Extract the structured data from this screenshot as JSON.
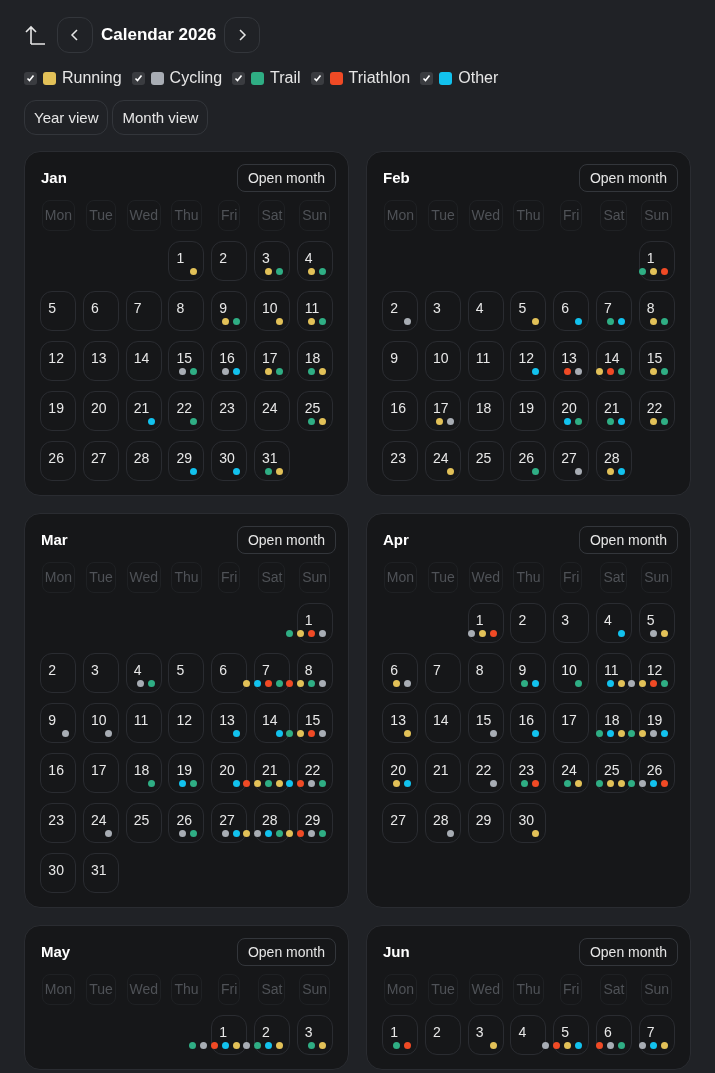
{
  "header": {
    "title": "Calendar 2026"
  },
  "categories": [
    {
      "label": "Running",
      "color": "#e2c158",
      "checked": true
    },
    {
      "label": "Cycling",
      "color": "#a8adb4",
      "checked": true
    },
    {
      "label": "Trail",
      "color": "#2fae84",
      "checked": true
    },
    {
      "label": "Triathlon",
      "color": "#f04a25",
      "checked": true
    },
    {
      "label": "Other",
      "color": "#12c2ee",
      "checked": true
    }
  ],
  "views": [
    {
      "label": "Year view"
    },
    {
      "label": "Month view"
    }
  ],
  "months": [
    {
      "name": "Jan",
      "button": "Open month",
      "weekdays": [
        "Mon",
        "Tue",
        "Wed",
        "Thu",
        "Fri",
        "Sat",
        "Sun"
      ],
      "days": [
        {
          "kind": "blank"
        },
        {
          "kind": "blank"
        },
        {
          "kind": "blank"
        },
        {
          "kind": "day",
          "day": "1",
          "dots": [
            {
              "color": "#e2c158"
            }
          ]
        },
        {
          "kind": "day",
          "day": "2"
        },
        {
          "kind": "day",
          "day": "3",
          "dots": [
            {
              "color": "#e2c158"
            },
            {
              "color": "#2fae84"
            }
          ]
        },
        {
          "kind": "day",
          "day": "4",
          "dots": [
            {
              "color": "#e2c158"
            },
            {
              "color": "#2fae84"
            }
          ]
        },
        {
          "kind": "day",
          "day": "5"
        },
        {
          "kind": "day",
          "day": "6"
        },
        {
          "kind": "day",
          "day": "7"
        },
        {
          "kind": "day",
          "day": "8"
        },
        {
          "kind": "day",
          "day": "9",
          "dots": [
            {
              "color": "#e2c158"
            },
            {
              "color": "#2fae84"
            }
          ]
        },
        {
          "kind": "day",
          "day": "10",
          "dots": [
            {
              "color": "#e2c158"
            }
          ]
        },
        {
          "kind": "day",
          "day": "11",
          "dots": [
            {
              "color": "#e2c158"
            },
            {
              "color": "#2fae84"
            }
          ]
        },
        {
          "kind": "day",
          "day": "12"
        },
        {
          "kind": "day",
          "day": "13"
        },
        {
          "kind": "day",
          "day": "14"
        },
        {
          "kind": "day",
          "day": "15",
          "dots": [
            {
              "color": "#a8adb4"
            },
            {
              "color": "#2fae84"
            }
          ]
        },
        {
          "kind": "day",
          "day": "16",
          "dots": [
            {
              "color": "#a8adb4"
            },
            {
              "color": "#12c2ee"
            }
          ]
        },
        {
          "kind": "day",
          "day": "17",
          "dots": [
            {
              "color": "#e2c158"
            },
            {
              "color": "#2fae84"
            }
          ]
        },
        {
          "kind": "day",
          "day": "18",
          "dots": [
            {
              "color": "#2fae84"
            },
            {
              "color": "#e2c158"
            }
          ]
        },
        {
          "kind": "day",
          "day": "19"
        },
        {
          "kind": "day",
          "day": "20"
        },
        {
          "kind": "day",
          "day": "21",
          "dots": [
            {
              "color": "#12c2ee"
            }
          ]
        },
        {
          "kind": "day",
          "day": "22",
          "dots": [
            {
              "color": "#2fae84"
            }
          ]
        },
        {
          "kind": "day",
          "day": "23"
        },
        {
          "kind": "day",
          "day": "24"
        },
        {
          "kind": "day",
          "day": "25",
          "dots": [
            {
              "color": "#2fae84"
            },
            {
              "color": "#e2c158"
            }
          ]
        },
        {
          "kind": "day",
          "day": "26"
        },
        {
          "kind": "day",
          "day": "27"
        },
        {
          "kind": "day",
          "day": "28"
        },
        {
          "kind": "day",
          "day": "29",
          "dots": [
            {
              "color": "#12c2ee"
            }
          ]
        },
        {
          "kind": "day",
          "day": "30",
          "dots": [
            {
              "color": "#12c2ee"
            }
          ]
        },
        {
          "kind": "day",
          "day": "31",
          "dots": [
            {
              "color": "#2fae84"
            },
            {
              "color": "#e2c158"
            }
          ]
        }
      ]
    },
    {
      "name": "Feb",
      "button": "Open month",
      "weekdays": [
        "Mon",
        "Tue",
        "Wed",
        "Thu",
        "Fri",
        "Sat",
        "Sun"
      ],
      "days": [
        {
          "kind": "blank"
        },
        {
          "kind": "blank"
        },
        {
          "kind": "blank"
        },
        {
          "kind": "blank"
        },
        {
          "kind": "blank"
        },
        {
          "kind": "blank"
        },
        {
          "kind": "day",
          "day": "1",
          "dots": [
            {
              "color": "#2fae84"
            },
            {
              "color": "#e2c158"
            },
            {
              "color": "#f04a25"
            }
          ]
        },
        {
          "kind": "day",
          "day": "2",
          "dots": [
            {
              "color": "#a8adb4"
            }
          ]
        },
        {
          "kind": "day",
          "day": "3"
        },
        {
          "kind": "day",
          "day": "4"
        },
        {
          "kind": "day",
          "day": "5",
          "dots": [
            {
              "color": "#e2c158"
            }
          ]
        },
        {
          "kind": "day",
          "day": "6",
          "dots": [
            {
              "color": "#12c2ee"
            }
          ]
        },
        {
          "kind": "day",
          "day": "7",
          "dots": [
            {
              "color": "#2fae84"
            },
            {
              "color": "#12c2ee"
            }
          ]
        },
        {
          "kind": "day",
          "day": "8",
          "dots": [
            {
              "color": "#e2c158"
            },
            {
              "color": "#2fae84"
            }
          ]
        },
        {
          "kind": "day",
          "day": "9"
        },
        {
          "kind": "day",
          "day": "10"
        },
        {
          "kind": "day",
          "day": "11"
        },
        {
          "kind": "day",
          "day": "12",
          "dots": [
            {
              "color": "#12c2ee"
            }
          ]
        },
        {
          "kind": "day",
          "day": "13",
          "dots": [
            {
              "color": "#f04a25"
            },
            {
              "color": "#a8adb4"
            }
          ]
        },
        {
          "kind": "day",
          "day": "14",
          "dots": [
            {
              "color": "#e2c158"
            },
            {
              "color": "#f04a25"
            },
            {
              "color": "#2fae84"
            }
          ]
        },
        {
          "kind": "day",
          "day": "15",
          "dots": [
            {
              "color": "#e2c158"
            },
            {
              "color": "#2fae84"
            }
          ]
        },
        {
          "kind": "day",
          "day": "16"
        },
        {
          "kind": "day",
          "day": "17",
          "dots": [
            {
              "color": "#e2c158"
            },
            {
              "color": "#a8adb4"
            }
          ]
        },
        {
          "kind": "day",
          "day": "18"
        },
        {
          "kind": "day",
          "day": "19"
        },
        {
          "kind": "day",
          "day": "20",
          "dots": [
            {
              "color": "#12c2ee"
            },
            {
              "color": "#2fae84"
            }
          ]
        },
        {
          "kind": "day",
          "day": "21",
          "dots": [
            {
              "color": "#2fae84"
            },
            {
              "color": "#12c2ee"
            }
          ]
        },
        {
          "kind": "day",
          "day": "22",
          "dots": [
            {
              "color": "#e2c158"
            },
            {
              "color": "#2fae84"
            }
          ]
        },
        {
          "kind": "day",
          "day": "23"
        },
        {
          "kind": "day",
          "day": "24",
          "dots": [
            {
              "color": "#e2c158"
            }
          ]
        },
        {
          "kind": "day",
          "day": "25"
        },
        {
          "kind": "day",
          "day": "26",
          "dots": [
            {
              "color": "#2fae84"
            }
          ]
        },
        {
          "kind": "day",
          "day": "27",
          "dots": [
            {
              "color": "#a8adb4"
            }
          ]
        },
        {
          "kind": "day",
          "day": "28",
          "dots": [
            {
              "color": "#e2c158"
            },
            {
              "color": "#12c2ee"
            }
          ]
        }
      ]
    },
    {
      "name": "Mar",
      "button": "Open month",
      "weekdays": [
        "Mon",
        "Tue",
        "Wed",
        "Thu",
        "Fri",
        "Sat",
        "Sun"
      ],
      "days": [
        {
          "kind": "blank"
        },
        {
          "kind": "blank"
        },
        {
          "kind": "blank"
        },
        {
          "kind": "blank"
        },
        {
          "kind": "blank"
        },
        {
          "kind": "blank"
        },
        {
          "kind": "day",
          "day": "1",
          "dots": [
            {
              "color": "#2fae84"
            },
            {
              "color": "#e2c158"
            },
            {
              "color": "#f04a25"
            },
            {
              "color": "#a8adb4"
            }
          ]
        },
        {
          "kind": "day",
          "day": "2"
        },
        {
          "kind": "day",
          "day": "3"
        },
        {
          "kind": "day",
          "day": "4",
          "dots": [
            {
              "color": "#a8adb4"
            },
            {
              "color": "#2fae84"
            }
          ]
        },
        {
          "kind": "day",
          "day": "5"
        },
        {
          "kind": "day",
          "day": "6"
        },
        {
          "kind": "day",
          "day": "7",
          "dots": [
            {
              "color": "#e2c158"
            },
            {
              "color": "#12c2ee"
            },
            {
              "color": "#f04a25"
            },
            {
              "color": "#2fae84"
            }
          ]
        },
        {
          "kind": "day",
          "day": "8",
          "dots": [
            {
              "color": "#f04a25"
            },
            {
              "color": "#e2c158"
            },
            {
              "color": "#2fae84"
            },
            {
              "color": "#a8adb4"
            }
          ]
        },
        {
          "kind": "day",
          "day": "9",
          "dots": [
            {
              "color": "#a8adb4"
            }
          ]
        },
        {
          "kind": "day",
          "day": "10",
          "dots": [
            {
              "color": "#a8adb4"
            }
          ]
        },
        {
          "kind": "day",
          "day": "11"
        },
        {
          "kind": "day",
          "day": "12"
        },
        {
          "kind": "day",
          "day": "13",
          "dots": [
            {
              "color": "#12c2ee"
            }
          ]
        },
        {
          "kind": "day",
          "day": "14",
          "dots": [
            {
              "color": "#12c2ee"
            }
          ]
        },
        {
          "kind": "day",
          "day": "15",
          "dots": [
            {
              "color": "#2fae84"
            },
            {
              "color": "#e2c158"
            },
            {
              "color": "#f04a25"
            },
            {
              "color": "#a8adb4"
            }
          ]
        },
        {
          "kind": "day",
          "day": "16"
        },
        {
          "kind": "day",
          "day": "17"
        },
        {
          "kind": "day",
          "day": "18",
          "dots": [
            {
              "color": "#2fae84"
            }
          ]
        },
        {
          "kind": "day",
          "day": "19",
          "dots": [
            {
              "color": "#12c2ee"
            },
            {
              "color": "#2fae84"
            }
          ]
        },
        {
          "kind": "day",
          "day": "20",
          "dots": [
            {
              "color": "#12c2ee"
            }
          ]
        },
        {
          "kind": "day",
          "day": "21",
          "dots": [
            {
              "color": "#f04a25"
            },
            {
              "color": "#e2c158"
            },
            {
              "color": "#2fae84"
            },
            {
              "color": "#e2c158"
            }
          ]
        },
        {
          "kind": "day",
          "day": "22",
          "dots": [
            {
              "color": "#12c2ee"
            },
            {
              "color": "#f04a25"
            },
            {
              "color": "#a8adb4"
            },
            {
              "color": "#2fae84"
            }
          ]
        },
        {
          "kind": "day",
          "day": "23"
        },
        {
          "kind": "day",
          "day": "24",
          "dots": [
            {
              "color": "#a8adb4"
            }
          ]
        },
        {
          "kind": "day",
          "day": "25"
        },
        {
          "kind": "day",
          "day": "26",
          "dots": [
            {
              "color": "#a8adb4"
            },
            {
              "color": "#2fae84"
            }
          ]
        },
        {
          "kind": "day",
          "day": "27",
          "dots": [
            {
              "color": "#a8adb4"
            },
            {
              "color": "#12c2ee"
            }
          ]
        },
        {
          "kind": "day",
          "day": "28",
          "dots": [
            {
              "color": "#e2c158"
            },
            {
              "color": "#a8adb4"
            },
            {
              "color": "#12c2ee"
            },
            {
              "color": "#2fae84"
            }
          ]
        },
        {
          "kind": "day",
          "day": "29",
          "dots": [
            {
              "color": "#e2c158"
            },
            {
              "color": "#f04a25"
            },
            {
              "color": "#a8adb4"
            },
            {
              "color": "#2fae84"
            }
          ]
        },
        {
          "kind": "day",
          "day": "30"
        },
        {
          "kind": "day",
          "day": "31"
        }
      ]
    },
    {
      "name": "Apr",
      "button": "Open month",
      "weekdays": [
        "Mon",
        "Tue",
        "Wed",
        "Thu",
        "Fri",
        "Sat",
        "Sun"
      ],
      "days": [
        {
          "kind": "blank"
        },
        {
          "kind": "blank"
        },
        {
          "kind": "day",
          "day": "1",
          "dots": [
            {
              "color": "#a8adb4"
            },
            {
              "color": "#e2c158"
            },
            {
              "color": "#f04a25"
            }
          ]
        },
        {
          "kind": "day",
          "day": "2"
        },
        {
          "kind": "day",
          "day": "3"
        },
        {
          "kind": "day",
          "day": "4",
          "dots": [
            {
              "color": "#12c2ee"
            }
          ]
        },
        {
          "kind": "day",
          "day": "5",
          "dots": [
            {
              "color": "#a8adb4"
            },
            {
              "color": "#e2c158"
            }
          ]
        },
        {
          "kind": "day",
          "day": "6",
          "dots": [
            {
              "color": "#e2c158"
            },
            {
              "color": "#a8adb4"
            }
          ]
        },
        {
          "kind": "day",
          "day": "7"
        },
        {
          "kind": "day",
          "day": "8"
        },
        {
          "kind": "day",
          "day": "9",
          "dots": [
            {
              "color": "#2fae84"
            },
            {
              "color": "#12c2ee"
            }
          ]
        },
        {
          "kind": "day",
          "day": "10",
          "dots": [
            {
              "color": "#2fae84"
            }
          ]
        },
        {
          "kind": "day",
          "day": "11",
          "dots": [
            {
              "color": "#12c2ee"
            },
            {
              "color": "#e2c158"
            }
          ]
        },
        {
          "kind": "day",
          "day": "12",
          "dots": [
            {
              "color": "#a8adb4"
            },
            {
              "color": "#e2c158"
            },
            {
              "color": "#f04a25"
            },
            {
              "color": "#2fae84"
            }
          ]
        },
        {
          "kind": "day",
          "day": "13",
          "dots": [
            {
              "color": "#e2c158"
            }
          ]
        },
        {
          "kind": "day",
          "day": "14"
        },
        {
          "kind": "day",
          "day": "15",
          "dots": [
            {
              "color": "#a8adb4"
            }
          ]
        },
        {
          "kind": "day",
          "day": "16",
          "dots": [
            {
              "color": "#12c2ee"
            }
          ]
        },
        {
          "kind": "day",
          "day": "17"
        },
        {
          "kind": "day",
          "day": "18",
          "dots": [
            {
              "color": "#2fae84"
            },
            {
              "color": "#12c2ee"
            },
            {
              "color": "#e2c158"
            }
          ]
        },
        {
          "kind": "day",
          "day": "19",
          "dots": [
            {
              "color": "#2fae84"
            },
            {
              "color": "#e2c158"
            },
            {
              "color": "#a8adb4"
            },
            {
              "color": "#12c2ee"
            }
          ]
        },
        {
          "kind": "day",
          "day": "20",
          "dots": [
            {
              "color": "#e2c158"
            },
            {
              "color": "#12c2ee"
            }
          ]
        },
        {
          "kind": "day",
          "day": "21"
        },
        {
          "kind": "day",
          "day": "22",
          "dots": [
            {
              "color": "#a8adb4"
            }
          ]
        },
        {
          "kind": "day",
          "day": "23",
          "dots": [
            {
              "color": "#2fae84"
            },
            {
              "color": "#f04a25"
            }
          ]
        },
        {
          "kind": "day",
          "day": "24",
          "dots": [
            {
              "color": "#2fae84"
            },
            {
              "color": "#e2c158"
            }
          ]
        },
        {
          "kind": "day",
          "day": "25",
          "dots": [
            {
              "color": "#2fae84"
            },
            {
              "color": "#e2c158"
            },
            {
              "color": "#e2c158"
            }
          ]
        },
        {
          "kind": "day",
          "day": "26",
          "dots": [
            {
              "color": "#2fae84"
            },
            {
              "color": "#a8adb4"
            },
            {
              "color": "#12c2ee"
            },
            {
              "color": "#f04a25"
            }
          ]
        },
        {
          "kind": "day",
          "day": "27"
        },
        {
          "kind": "day",
          "day": "28",
          "dots": [
            {
              "color": "#a8adb4"
            }
          ]
        },
        {
          "kind": "day",
          "day": "29"
        },
        {
          "kind": "day",
          "day": "30",
          "dots": [
            {
              "color": "#e2c158"
            }
          ]
        }
      ]
    },
    {
      "name": "May",
      "button": "Open month",
      "weekdays": [
        "Mon",
        "Tue",
        "Wed",
        "Thu",
        "Fri",
        "Sat",
        "Sun"
      ],
      "days": [
        {
          "kind": "blank"
        },
        {
          "kind": "blank"
        },
        {
          "kind": "blank"
        },
        {
          "kind": "blank"
        },
        {
          "kind": "day",
          "day": "1",
          "dots": [
            {
              "color": "#2fae84"
            },
            {
              "color": "#a8adb4"
            },
            {
              "color": "#f04a25"
            },
            {
              "color": "#12c2ee"
            },
            {
              "color": "#e2c158"
            }
          ]
        },
        {
          "kind": "day",
          "day": "2",
          "dots": [
            {
              "color": "#a8adb4"
            },
            {
              "color": "#2fae84"
            },
            {
              "color": "#12c2ee"
            },
            {
              "color": "#e2c158"
            }
          ]
        },
        {
          "kind": "day",
          "day": "3",
          "dots": [
            {
              "color": "#2fae84"
            },
            {
              "color": "#e2c158"
            }
          ]
        }
      ]
    },
    {
      "name": "Jun",
      "button": "Open month",
      "weekdays": [
        "Mon",
        "Tue",
        "Wed",
        "Thu",
        "Fri",
        "Sat",
        "Sun"
      ],
      "days": [
        {
          "kind": "day",
          "day": "1",
          "dots": [
            {
              "color": "#2fae84"
            },
            {
              "color": "#f04a25"
            }
          ]
        },
        {
          "kind": "day",
          "day": "2"
        },
        {
          "kind": "day",
          "day": "3",
          "dots": [
            {
              "color": "#e2c158"
            }
          ]
        },
        {
          "kind": "day",
          "day": "4"
        },
        {
          "kind": "day",
          "day": "5",
          "dots": [
            {
              "color": "#a8adb4"
            },
            {
              "color": "#f04a25"
            },
            {
              "color": "#e2c158"
            },
            {
              "color": "#12c2ee"
            }
          ]
        },
        {
          "kind": "day",
          "day": "6",
          "dots": [
            {
              "color": "#f04a25"
            },
            {
              "color": "#a8adb4"
            },
            {
              "color": "#2fae84"
            }
          ]
        },
        {
          "kind": "day",
          "day": "7",
          "dots": [
            {
              "color": "#a8adb4"
            },
            {
              "color": "#12c2ee"
            },
            {
              "color": "#e2c158"
            }
          ]
        }
      ]
    }
  ]
}
